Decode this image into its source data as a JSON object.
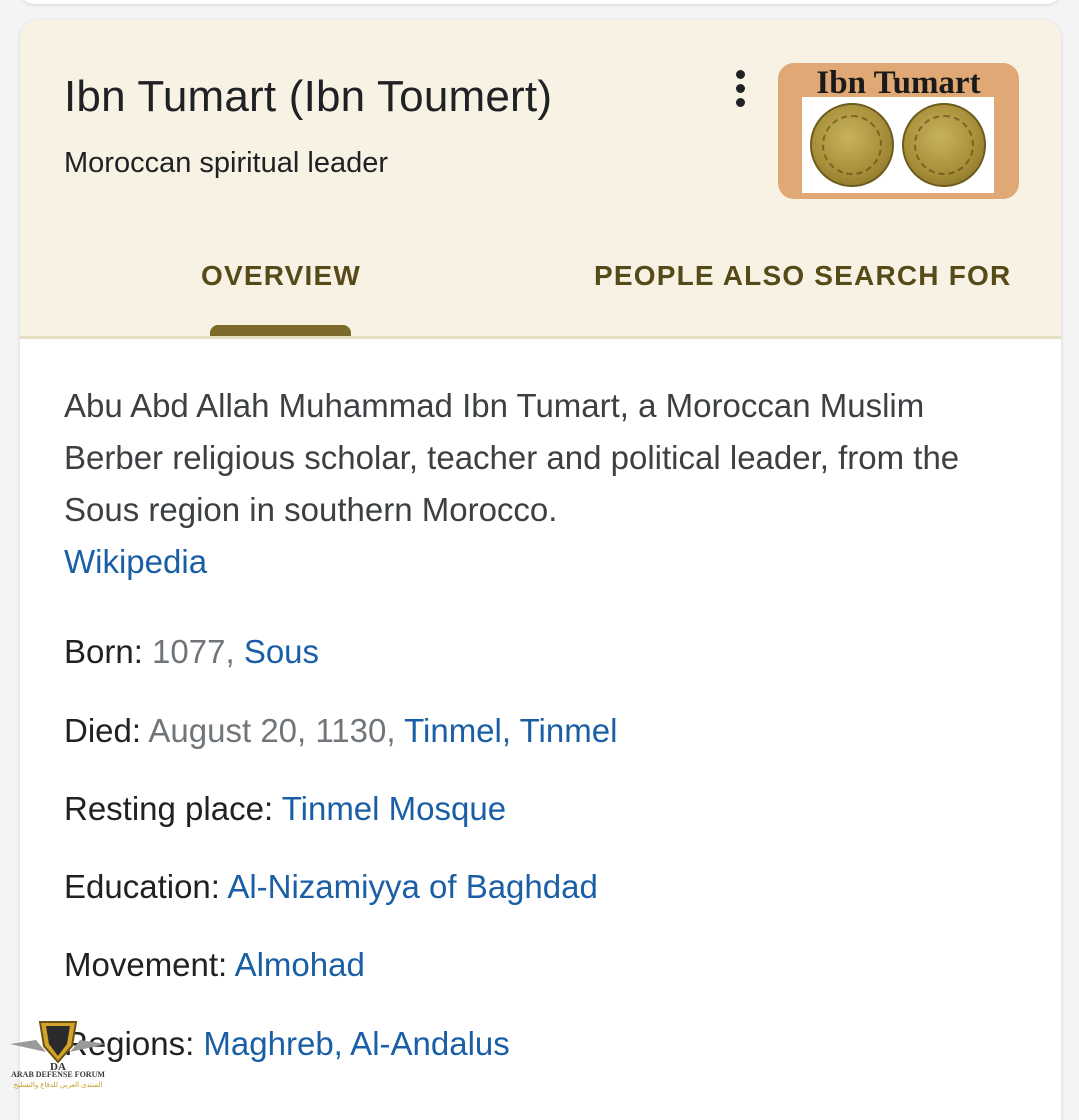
{
  "panel": {
    "title": "Ibn Tumart (Ibn Toumert)",
    "subtitle": "Moroccan spiritual leader",
    "more_icon": "more-vertical-icon",
    "thumbnail": {
      "caption": "Ibn Tumart"
    }
  },
  "tabs": [
    {
      "label": "OVERVIEW",
      "selected": true
    },
    {
      "label": "PEOPLE ALSO SEARCH FOR",
      "selected": false
    }
  ],
  "description": {
    "text": "Abu Abd Allah Muhammad Ibn Tumart, a Moroccan Muslim Berber religious scholar, teacher and political leader, from the Sous region in southern Morocco.",
    "source": "Wikipedia"
  },
  "facts": [
    {
      "label": "Born:",
      "value": "1077,",
      "link": "Sous"
    },
    {
      "label": "Died:",
      "value": "August 20, 1130,",
      "link": "Tinmel, Tinmel"
    },
    {
      "label": "Resting place:",
      "value": "",
      "link": "Tinmel Mosque"
    },
    {
      "label": "Education:",
      "value": "",
      "link": "Al-Nizamiyya of Baghdad"
    },
    {
      "label": "Movement:",
      "value": "",
      "link": "Almohad"
    },
    {
      "label": "Regions:",
      "value": "",
      "link": "Maghreb, Al-Andalus"
    }
  ],
  "watermark": {
    "monogram": "DA",
    "text": "ARAB DEFENSE FORUM",
    "subtext": "المنتدى العربي للدفاع والتسليح"
  },
  "colors": {
    "header_bg": "#f7f2e3",
    "tab_text": "#574a19",
    "tab_indicator": "#7b6a2a",
    "link": "#1a5fa6",
    "muted_value": "#70757a"
  }
}
